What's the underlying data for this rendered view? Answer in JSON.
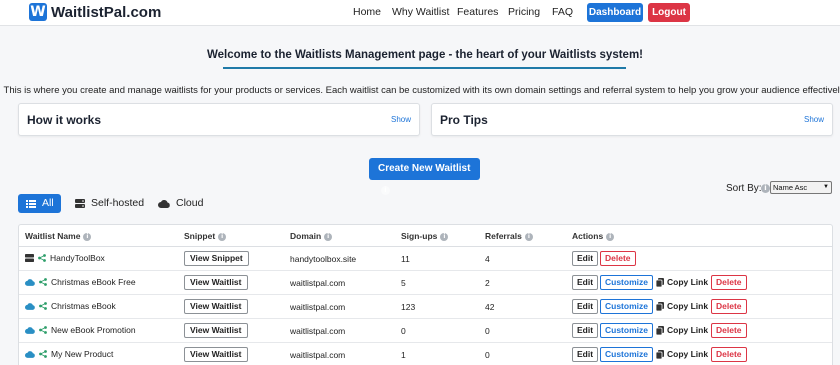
{
  "brand": {
    "badge": "W",
    "name": "WaitlistPal.com"
  },
  "nav": {
    "home": "Home",
    "why": "Why Waitlist",
    "features": "Features",
    "pricing": "Pricing",
    "faq": "FAQ",
    "dashboard": "Dashboard",
    "logout": "Logout"
  },
  "header": {
    "title": "Welcome to the Waitlists Management page - the heart of your Waitlists system!",
    "intro": "This is where you create and manage waitlists for your products or services. Each waitlist can be customized with its own domain settings and referral system to help you grow your audience effectively."
  },
  "panels": {
    "how": {
      "title": "How it works",
      "toggle": "Show"
    },
    "tips": {
      "title": "Pro Tips",
      "toggle": "Show"
    }
  },
  "create_button": "Create New Waitlist",
  "sort": {
    "label": "Sort By:",
    "selected": "Name Asc"
  },
  "filters": {
    "all": "All",
    "self_hosted": "Self-hosted",
    "cloud": "Cloud"
  },
  "table": {
    "headers": {
      "name": "Waitlist Name",
      "snippet": "Snippet",
      "domain": "Domain",
      "signups": "Sign-ups",
      "referrals": "Referrals",
      "actions": "Actions"
    },
    "action_labels": {
      "edit": "Edit",
      "customize": "Customize",
      "copy": "Copy Link",
      "delete": "Delete"
    },
    "rows": [
      {
        "name": "HandyToolBox",
        "type": "self-hosted",
        "snippet": "View Snippet",
        "domain": "handytoolbox.site",
        "signups": "11",
        "referrals": "4"
      },
      {
        "name": "Christmas eBook Free",
        "type": "cloud",
        "snippet": "View Waitlist",
        "domain": "waitlistpal.com",
        "signups": "5",
        "referrals": "2"
      },
      {
        "name": "Christmas eBook",
        "type": "cloud",
        "snippet": "View Waitlist",
        "domain": "waitlistpal.com",
        "signups": "123",
        "referrals": "42"
      },
      {
        "name": "New eBook Promotion",
        "type": "cloud",
        "snippet": "View Waitlist",
        "domain": "waitlistpal.com",
        "signups": "0",
        "referrals": "0"
      },
      {
        "name": "My New Product",
        "type": "cloud",
        "snippet": "View Waitlist",
        "domain": "waitlistpal.com",
        "signups": "1",
        "referrals": "0"
      }
    ]
  },
  "colors": {
    "primary": "#1d74d8",
    "danger": "#dc3545",
    "accent_line": "#1f7aa8"
  }
}
